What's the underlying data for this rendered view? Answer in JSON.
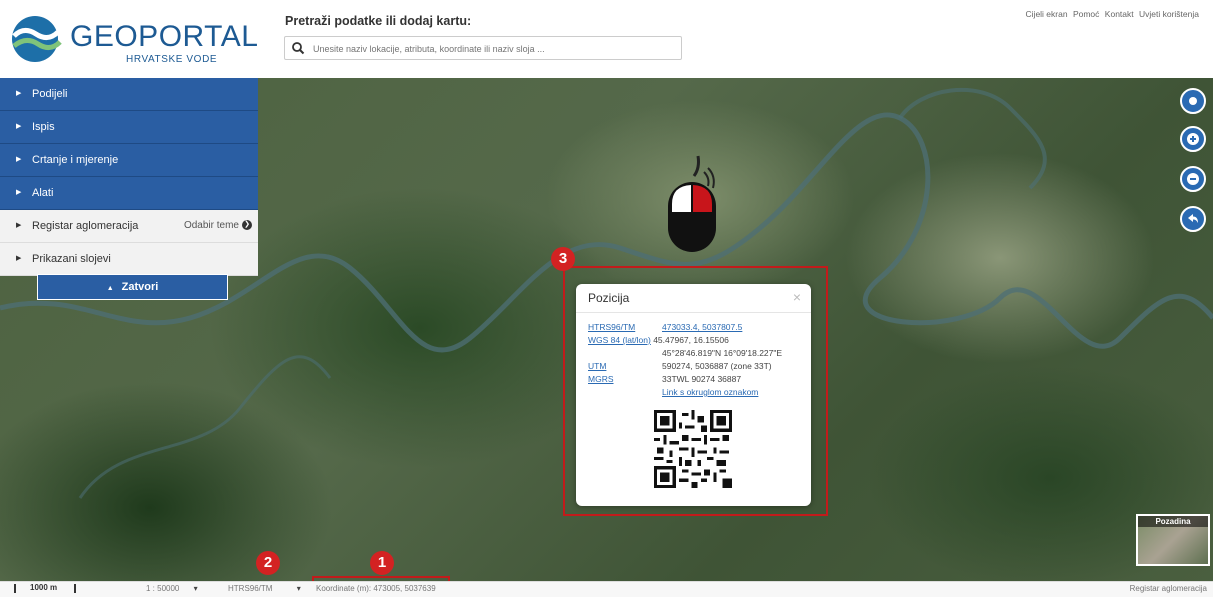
{
  "header": {
    "logo_text": "GEOPORTAL",
    "logo_sub": "HRVATSKE VODE",
    "search_label": "Pretraži podatke ili dodaj kartu:",
    "search_placeholder": "Unesite naziv lokacije, atributa, koordinate ili naziv sloja ...",
    "top_links": [
      "Cijeli ekran",
      "Pomoć",
      "Kontakt",
      "Uvjeti korištenja"
    ]
  },
  "sidebar": {
    "nav_items": [
      {
        "label": "Podijeli"
      },
      {
        "label": "Ispis"
      },
      {
        "label": "Crtanje i mjerenje"
      },
      {
        "label": "Alati"
      }
    ],
    "sub_items": [
      {
        "label": "Registar aglomeracija",
        "extra": "Odabir teme"
      },
      {
        "label": "Prikazani slojevi"
      }
    ],
    "close_label": "Zatvori"
  },
  "map_controls": [
    "locate-icon",
    "zoom-in-icon",
    "zoom-out-icon",
    "back-icon"
  ],
  "badges": {
    "b1": "1",
    "b2": "2",
    "b3": "3"
  },
  "popup": {
    "title": "Pozicija",
    "close": "×",
    "rows": [
      {
        "label": "HTRS96/TM",
        "value": "473033.4, 5037807.5"
      },
      {
        "label": "WGS 84 (lat/lon)",
        "value": "45.47967, 16.15506"
      },
      {
        "label": "",
        "value": "45°28'46.819\"N 16°09'18.227\"E"
      },
      {
        "label": "UTM",
        "value": "590274, 5036887 (zone 33T)"
      },
      {
        "label": "MGRS",
        "value": "33TWL 90274 36887"
      }
    ],
    "link": "Link s okruglom oznakom"
  },
  "overview": {
    "label": "Pozadina"
  },
  "bottom": {
    "scale": "1000 m",
    "scale_select": "1 : 50000",
    "crs_select": "HTRS96/TM",
    "coords": "Koordinate (m): 473005, 5037639",
    "right_link": "Registar aglomeracija"
  },
  "colors": {
    "brand": "#2a5ea3",
    "accent_red": "#d32222"
  }
}
